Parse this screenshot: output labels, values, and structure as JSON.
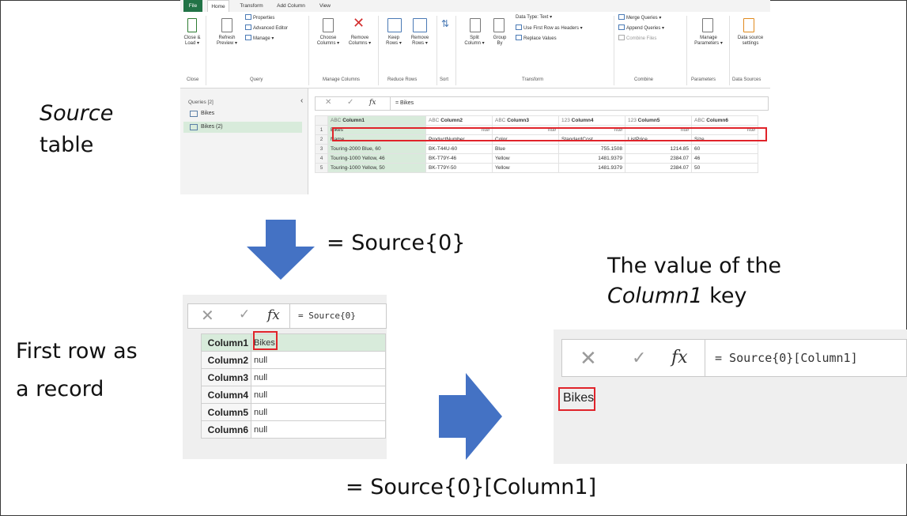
{
  "labels": {
    "source_word": "Source",
    "table_word": "table",
    "first_row_line1": "First row as",
    "first_row_line2": "a record",
    "value_line1": "The value of the",
    "value_col_key": "Column1",
    "value_key_word": " key",
    "formula_source0": "= Source{0}",
    "formula_bottom": "= Source{0}[Column1]"
  },
  "ribbon": {
    "tabs": [
      "File",
      "Home",
      "Transform",
      "Add Column",
      "View"
    ],
    "close_load": [
      "Close &",
      "Load ▾"
    ],
    "refresh": [
      "Refresh",
      "Preview ▾"
    ],
    "properties": "Properties",
    "advanced_editor": "Advanced Editor",
    "manage": "Manage ▾",
    "choose_cols": [
      "Choose",
      "Columns ▾"
    ],
    "remove_cols": [
      "Remove",
      "Columns ▾"
    ],
    "keep_rows": [
      "Keep",
      "Rows ▾"
    ],
    "remove_rows": [
      "Remove",
      "Rows ▾"
    ],
    "split_col": [
      "Split",
      "Column ▾"
    ],
    "group_by": [
      "Group",
      "By"
    ],
    "data_type": "Data Type: Text ▾",
    "first_row_headers": "Use First Row as Headers ▾",
    "replace_values": "Replace Values",
    "merge_queries": "Merge Queries ▾",
    "append_queries": "Append Queries ▾",
    "combine_files": "Combine Files",
    "manage_params": [
      "Manage",
      "Parameters ▾"
    ],
    "data_source_settings": [
      "Data source",
      "settings"
    ],
    "groups": [
      "Close",
      "Query",
      "Manage Columns",
      "Reduce Rows",
      "Sort",
      "Transform",
      "Combine",
      "Parameters",
      "Data Sources"
    ]
  },
  "queries": {
    "header": "Queries [2]",
    "items": [
      "Bikes",
      "Bikes (2)"
    ]
  },
  "formula_bar": {
    "x": "✕",
    "check": "✓",
    "fx": "fx",
    "main": "= Bikes",
    "record": "= Source{0}",
    "value": "= Source{0}[Column1]"
  },
  "grid": {
    "headers": [
      "Column1",
      "Column2",
      "Column3",
      "Column4",
      "Column5",
      "Column6"
    ],
    "type_tags": [
      "ABC",
      "ABC",
      "ABC",
      "123",
      "123",
      "ABC"
    ],
    "rows": [
      [
        "1",
        "Bikes",
        "null",
        "null",
        "null",
        "null",
        "null"
      ],
      [
        "2",
        "Name",
        "ProductNumber",
        "Color",
        "StandardCost",
        "ListPrice",
        "Size"
      ],
      [
        "3",
        "Touring-2000 Blue, 60",
        "BK-T44U-60",
        "Blue",
        "755.1508",
        "1214.85",
        "60"
      ],
      [
        "4",
        "Touring-1000 Yellow, 46",
        "BK-T79Y-46",
        "Yellow",
        "1481.9379",
        "2384.07",
        "46"
      ],
      [
        "5",
        "Touring-1000 Yellow, 50",
        "BK-T79Y-50",
        "Yellow",
        "1481.9379",
        "2384.07",
        "50"
      ]
    ]
  },
  "record": {
    "keys": [
      "Column1",
      "Column2",
      "Column3",
      "Column4",
      "Column5",
      "Column6"
    ],
    "values": [
      "Bikes",
      "null",
      "null",
      "null",
      "null",
      "null"
    ]
  },
  "value_result": "Bikes",
  "colors": {
    "highlight": "#e0232a",
    "arrow": "#4472c4",
    "selected_col": "#d8ebdb",
    "file_tab": "#217346"
  }
}
